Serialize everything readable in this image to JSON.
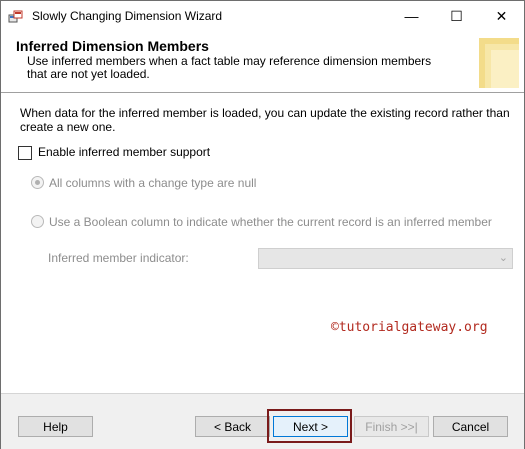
{
  "window": {
    "title": "Slowly Changing Dimension Wizard",
    "minimize_glyph": "—",
    "maximize_glyph": "☐",
    "close_glyph": "✕"
  },
  "header": {
    "title": "Inferred Dimension Members",
    "subtitle": "Use inferred members when a fact table may reference dimension members that are not yet loaded."
  },
  "body": {
    "intro": "When data for the inferred member is loaded, you can update the existing record rather than create a new one.",
    "enable_checkbox": {
      "label": "Enable inferred member support",
      "checked": false
    },
    "radio_all_null": {
      "label": "All columns with a change type are null",
      "selected": true,
      "enabled": false
    },
    "radio_boolean": {
      "label": "Use a Boolean column to indicate whether the current record is an inferred member",
      "selected": false,
      "enabled": false
    },
    "indicator": {
      "label": "Inferred member indicator:",
      "value": ""
    },
    "watermark": "©tutorialgateway.org"
  },
  "footer": {
    "help": "Help",
    "back": "< Back",
    "next": "Next >",
    "finish": "Finish >>|",
    "cancel": "Cancel"
  },
  "colors": {
    "accent": "#0078d7",
    "highlight_border": "#7a1a1a",
    "watermark": "#b22a1f",
    "disabled_text": "#8d8d8d"
  }
}
